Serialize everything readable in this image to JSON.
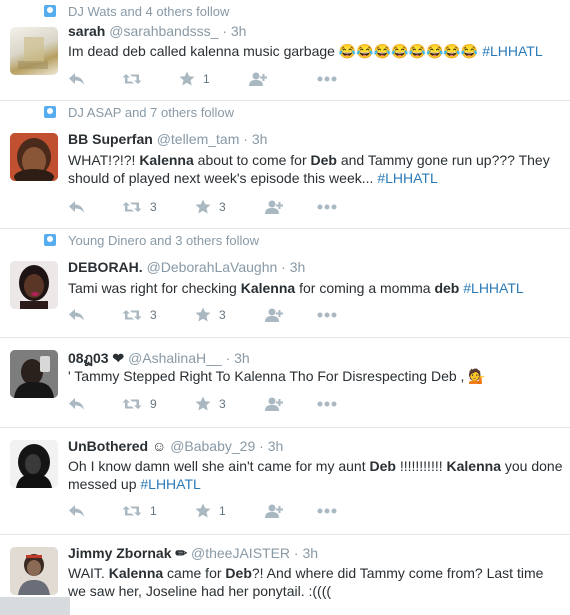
{
  "colors": {
    "link": "#2b7bb9",
    "muted": "#8899a6",
    "text": "#292f33",
    "action": "#aab8c2",
    "divider": "#e1e8ed",
    "context_icon": "#55acee"
  },
  "icons": {
    "context": "follow-context-icon",
    "reply": "reply-icon",
    "retweet": "retweet-icon",
    "favorite": "star-icon",
    "follow": "follow-icon",
    "more": "more-icon"
  },
  "tweets": [
    {
      "context": "DJ Wats and 4 others follow",
      "name": "sarah",
      "handle": "@sarahbandsss_",
      "sep": "·",
      "time": "3h",
      "segments": [
        {
          "t": "Im dead deb called kalenna music garbage ",
          "s": "n"
        },
        {
          "t": "😂😂😂😂😂😂😂😂",
          "s": "emoji"
        },
        {
          "t": " ",
          "s": "n"
        },
        {
          "t": "#LHHATL",
          "s": "tag"
        }
      ],
      "retweets": "",
      "favorites": "1"
    },
    {
      "context": "DJ ASAP and 7 others follow",
      "name": "BB Superfan",
      "handle": "@tellem_tam",
      "sep": "·",
      "time": "3h",
      "segments": [
        {
          "t": "WHAT!?!?! ",
          "s": "n"
        },
        {
          "t": "Kalenna",
          "s": "b"
        },
        {
          "t": " about to come for ",
          "s": "n"
        },
        {
          "t": "Deb",
          "s": "b"
        },
        {
          "t": " and Tammy gone run up??? They should of played next week's episode this week... ",
          "s": "n"
        },
        {
          "t": "#LHHATL",
          "s": "tag"
        }
      ],
      "retweets": "3",
      "favorites": "3"
    },
    {
      "context": "Young Dinero and 3 others follow",
      "name": "DEBORAH.",
      "handle": "@DeborahLaVaughn",
      "sep": "·",
      "time": "3h",
      "segments": [
        {
          "t": "Tami was right for checking ",
          "s": "n"
        },
        {
          "t": "Kalenna",
          "s": "b"
        },
        {
          "t": " for coming a momma ",
          "s": "n"
        },
        {
          "t": "deb",
          "s": "b"
        },
        {
          "t": " ",
          "s": "n"
        },
        {
          "t": "#LHHATL",
          "s": "tag"
        }
      ],
      "retweets": "3",
      "favorites": "3"
    },
    {
      "context": "",
      "name": "08ฏ03 ❤",
      "handle": "@AshalinaH__",
      "sep": "·",
      "time": "3h",
      "segments": [
        {
          "t": "' Tammy Stepped Right To Kalenna Tho For Disrespecting Deb , 💁",
          "s": "n"
        }
      ],
      "retweets": "9",
      "favorites": "3"
    },
    {
      "context": "",
      "name": "UnBothered ☺",
      "handle": "@Bababy_29",
      "sep": "·",
      "time": "3h",
      "segments": [
        {
          "t": "Oh I know damn well she ain't came for my aunt ",
          "s": "n"
        },
        {
          "t": "Deb",
          "s": "b"
        },
        {
          "t": "  !!!!!!!!!!! ",
          "s": "n"
        },
        {
          "t": "Kalenna",
          "s": "b"
        },
        {
          "t": " you done messed up ",
          "s": "n"
        },
        {
          "t": "#LHHATL",
          "s": "tag"
        }
      ],
      "retweets": "1",
      "favorites": "1"
    },
    {
      "context": "",
      "name": "Jimmy Zbornak ✏",
      "handle": "@theeJAISTER",
      "sep": "·",
      "time": "3h",
      "segments": [
        {
          "t": "WAIT. ",
          "s": "n"
        },
        {
          "t": "Kalenna",
          "s": "b"
        },
        {
          "t": " came for ",
          "s": "n"
        },
        {
          "t": "Deb",
          "s": "b"
        },
        {
          "t": "?! And where did Tammy come from? Last time we saw her, Joseline had her ponytail. :((((",
          "s": "n"
        }
      ],
      "retweets": "",
      "favorites": ""
    }
  ]
}
